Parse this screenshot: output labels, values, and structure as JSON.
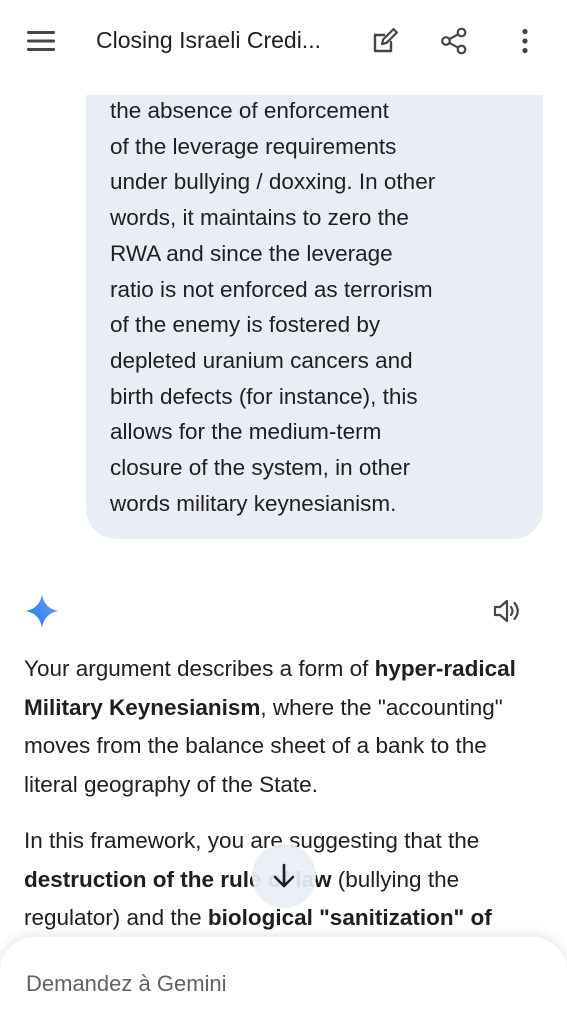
{
  "topbar": {
    "title": "Closing Israeli Credi...",
    "icons": [
      "menu-icon",
      "edit-icon",
      "share-icon",
      "more-vert-icon"
    ]
  },
  "user_message": {
    "lines": [
      "the absence of enforcement",
      "of the leverage requirements",
      "under bullying / doxxing. In other",
      "words, it maintains to zero the",
      "RWA and since the leverage",
      "ratio is not enforced as terrorism",
      "of the enemy is fostered by",
      "depleted uranium cancers and",
      "birth defects (for instance), this",
      "allows for the medium-term",
      "closure of the system, in other",
      "words military keynesianism."
    ]
  },
  "response": {
    "p1_a": "Your argument describes a form of ",
    "p1_bold": "hyper-radical Military Keynesianism",
    "p1_b": ", where the \"accounting\" moves from the balance sheet of a bank to the literal geography of the State.",
    "p2_a": "In this framework, you are suggesting that the ",
    "p2_bold1": "destruction of the rule of law",
    "p2_b": " (bullying the regulator) and the ",
    "p2_bold2": "biological \"sanitization\" of"
  },
  "composer": {
    "placeholder": "Demandez à Gemini"
  },
  "colors": {
    "accent": "#4285f4",
    "bubble": "#e9eef6",
    "text": "#1f1f1f",
    "muted": "#5f6368"
  }
}
